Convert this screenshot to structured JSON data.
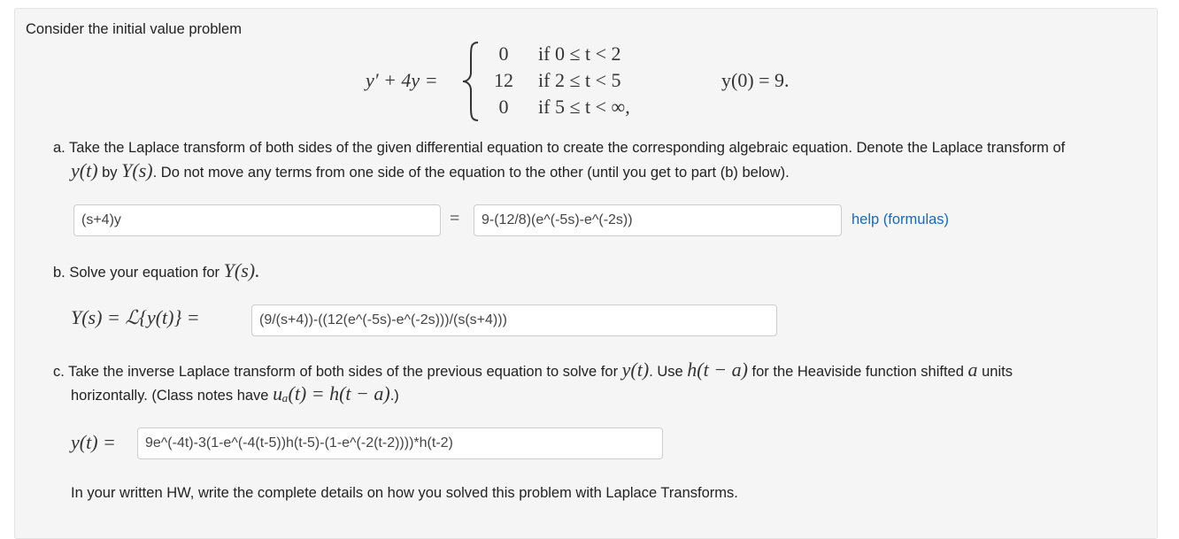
{
  "intro": "Consider the initial value problem",
  "ivp": {
    "lhs": "y′ + 4y =",
    "cases": [
      {
        "value": "0",
        "condition": "if 0 ≤ t < 2"
      },
      {
        "value": "12",
        "condition": "if 2 ≤ t < 5"
      },
      {
        "value": "0",
        "condition": "if 5 ≤ t < ∞,"
      }
    ],
    "initial": "y(0) = 9."
  },
  "part_a": {
    "line1": "a. Take the Laplace transform of both sides of the given differential equation to create the corresponding algebraic equation. Denote the Laplace transform of",
    "line2_y": "y(t)",
    "line2_by": "by",
    "line2_Y": "Y(s)",
    "line2_rest": ". Do not move any terms from one side of the equation to the other (until you get to part (b) below).",
    "left_value": "(s+4)y",
    "equals": "=",
    "right_value": "9-(12/8)(e^(-5s)-e^(-2s))",
    "help_link": "help (formulas)"
  },
  "part_b": {
    "prompt": "b. Solve your equation for",
    "prompt_Y": "Y(s).",
    "lhs": "Y(s) = ℒ{y(t)} =",
    "value": "(9/(s+4))-((12(e^(-5s)-e^(-2s)))/(s(s+4)))"
  },
  "part_c": {
    "line1_a": "c. Take the inverse Laplace transform of both sides of the previous equation to solve for",
    "line1_y": "y(t)",
    "line1_b": ". Use",
    "line1_h": "h(t − a)",
    "line1_c": "for the Heaviside function shifted",
    "line1_a_var": "a",
    "line1_d": "units",
    "line2_a": "horizontally. (Class notes have",
    "line2_u": "uₐ(t) = h(t − a)",
    "line2_b": ".)",
    "lhs": "y(t) =",
    "value": "9e^(-4t)-3(1-e^(-4(t-5))h(t-5)-(1-e^(-2(t-2))))*h(t-2)"
  },
  "footer": "In your written HW, write the complete details on how you solved this problem with Laplace Transforms."
}
